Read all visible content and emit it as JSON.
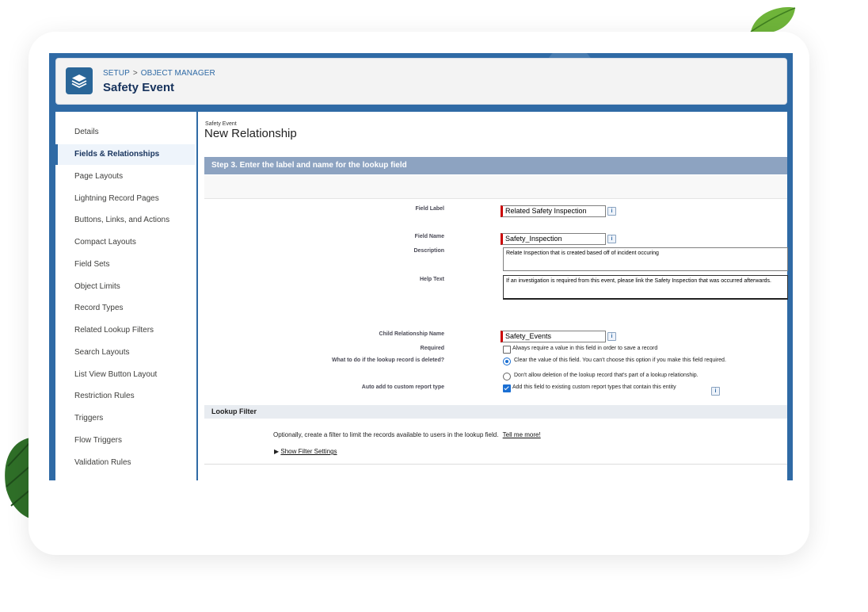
{
  "breadcrumb": {
    "setup": "SETUP",
    "separator": ">",
    "object_manager": "OBJECT MANAGER"
  },
  "object": {
    "title": "Safety Event",
    "icon": "layers-icon"
  },
  "sidebar": {
    "items": [
      {
        "label": "Details",
        "active": false
      },
      {
        "label": "Fields & Relationships",
        "active": true
      },
      {
        "label": "Page Layouts",
        "active": false
      },
      {
        "label": "Lightning Record Pages",
        "active": false
      },
      {
        "label": "Buttons, Links, and Actions",
        "active": false
      },
      {
        "label": "Compact Layouts",
        "active": false
      },
      {
        "label": "Field Sets",
        "active": false
      },
      {
        "label": "Object Limits",
        "active": false
      },
      {
        "label": "Record Types",
        "active": false
      },
      {
        "label": "Related Lookup Filters",
        "active": false
      },
      {
        "label": "Search Layouts",
        "active": false
      },
      {
        "label": "List View Button Layout",
        "active": false
      },
      {
        "label": "Restriction Rules",
        "active": false
      },
      {
        "label": "Triggers",
        "active": false
      },
      {
        "label": "Flow Triggers",
        "active": false
      },
      {
        "label": "Validation Rules",
        "active": false
      }
    ]
  },
  "main": {
    "object_type": "Safety Event",
    "page_title": "New Relationship",
    "step_title": "Step 3. Enter the label and name for the lookup field"
  },
  "form": {
    "field_label": {
      "label": "Field Label",
      "value": "Related Safety Inspection"
    },
    "field_name": {
      "label": "Field Name",
      "value": "Safety_Inspection"
    },
    "description": {
      "label": "Description",
      "value": "Relate Inspection that is created based off of incident occuring"
    },
    "help_text": {
      "label": "Help Text",
      "value": "If an investigation is required from this event, please link the Safety Inspection that was occurred afterwards."
    },
    "child_rel": {
      "label": "Child Relationship Name",
      "value": "Safety_Events"
    },
    "required": {
      "label": "Required",
      "option": "Always require a value in this field in order to save a record",
      "checked": false
    },
    "lookup_deleted": {
      "label": "What to do if the lookup record is deleted?",
      "option_clear": "Clear the value of this field. You can't choose this option if you make this field required.",
      "option_dont": "Don't allow deletion of the lookup record that's part of a lookup relationship.",
      "selected": "clear"
    },
    "auto_add": {
      "label": "Auto add to custom report type",
      "option": "Add this field to existing custom report types that contain this entity",
      "checked": true
    },
    "info_glyph": "i"
  },
  "lookup_filter": {
    "title": "Lookup Filter",
    "description": "Optionally, create a filter to limit the records available to users in the lookup field.",
    "tell_more": "Tell me more!",
    "show_settings": "Show Filter Settings"
  },
  "colors": {
    "header_blue": "#2f6aa5",
    "step_bar": "#8da3c1",
    "required_red": "#cc0000"
  }
}
